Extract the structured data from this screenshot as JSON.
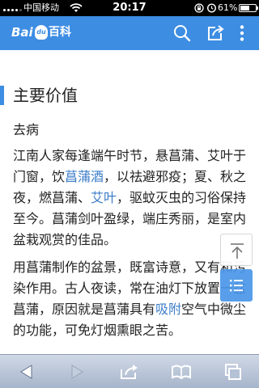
{
  "status_bar": {
    "carrier": "中国移动",
    "time": "20:17",
    "battery_percent": "61%",
    "battery_level": 0.61,
    "icons": [
      "signal-icon",
      "wifi-icon",
      "rotation-lock-icon",
      "alarm-icon",
      "battery-icon"
    ]
  },
  "header": {
    "logo_bai": "Bai",
    "logo_du": "du",
    "logo_baike": "百科",
    "accent_color": "#3d8de3",
    "icons": [
      "search-icon",
      "share-icon",
      "more-icon"
    ]
  },
  "article": {
    "section_title": "主要价值",
    "subheading": "去病",
    "para1": {
      "t1": "江南人家每逢端午时节，悬菖蒲、艾叶于门窗，饮",
      "link1": "菖蒲酒",
      "t2": "，以祛避邪疫；夏、秋之夜，燃菖蒲、",
      "link2": "艾叶",
      "t3": "，驱蚊灭虫的习俗保持至今。菖蒲剑叶盈绿，端庄秀丽，是室内盆栽观赏的佳品。"
    },
    "para2": {
      "t1": "用菖蒲制作的盆景，既富诗意，又有和污染作用。古人夜读，常在油灯下放置一盆菖蒲，原因就是菖蒲具有",
      "link1": "吸附",
      "t2": "空气中微尘的功能，可免灯烟熏眼之苦。"
    },
    "link_color": "#3d7dc8"
  },
  "floating": {
    "icons": [
      "back-to-top-icon",
      "table-of-contents-icon"
    ]
  },
  "toolbar": {
    "icons": [
      "back-arrow-icon",
      "forward-arrow-icon",
      "share-icon",
      "bookmarks-icon",
      "tabs-icon"
    ]
  }
}
